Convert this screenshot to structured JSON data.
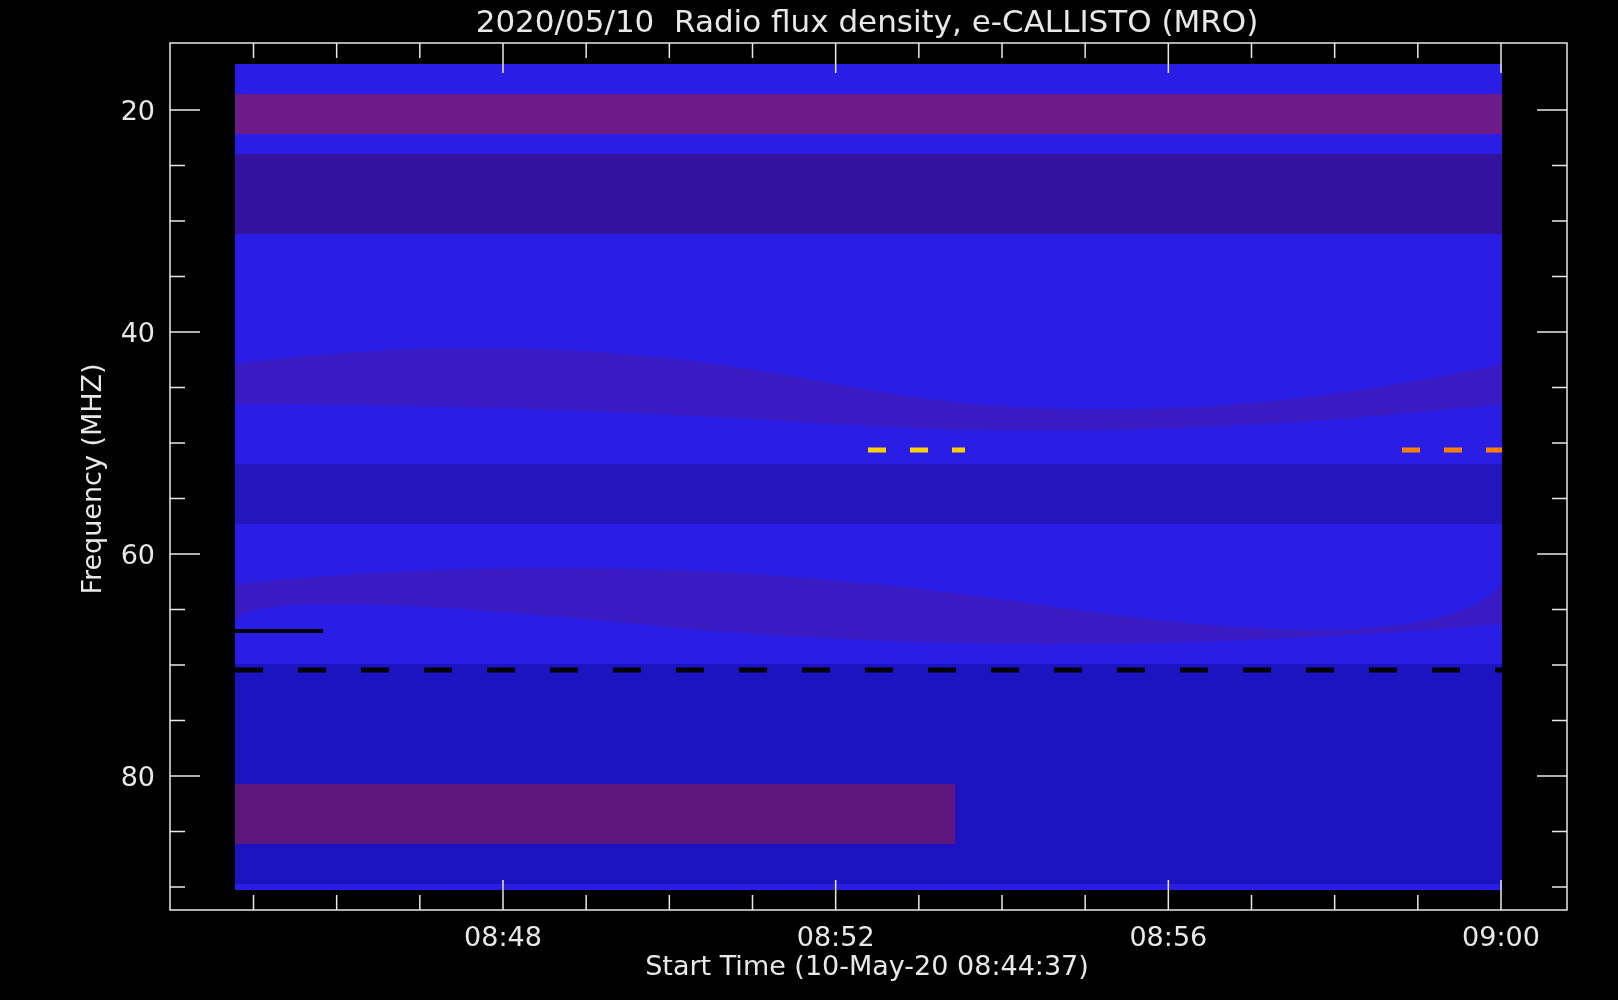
{
  "title": "2020/05/10  Radio flux density, e-CALLISTO (MRO)",
  "y_axis": {
    "label": "Frequency (MHZ)",
    "ticks": [
      "20",
      "40",
      "60",
      "80"
    ]
  },
  "x_axis": {
    "label": "Start Time (10-May-20 08:44:37)",
    "ticks": [
      "08:48",
      "08:52",
      "08:56",
      "09:00"
    ]
  }
}
